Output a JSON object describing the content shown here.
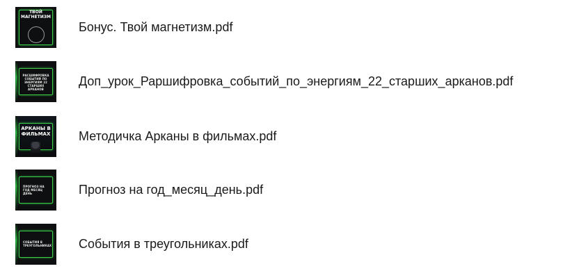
{
  "files": [
    {
      "name": "Бонус. Твой магнетизм.pdf",
      "thumbnail_icon": "pdf-cover-thumbnail",
      "thumbnail_text": "ТВОЙ МАГНЕТИЗМ"
    },
    {
      "name": "Доп_урок_Раршифровка_событий_по_энергиям_22_старших_арканов.pdf",
      "thumbnail_icon": "pdf-cover-thumbnail",
      "thumbnail_text": "РАСШИФРОВКА СОБЫТИЙ ПО ЭНЕРГИЯМ 22 СТАРШИХ АРКАНОВ"
    },
    {
      "name": "Методичка Арканы в фильмах.pdf",
      "thumbnail_icon": "pdf-cover-thumbnail",
      "thumbnail_text": "АРКАНЫ В ФИЛЬМАХ"
    },
    {
      "name": "Прогноз на год_месяц_день.pdf",
      "thumbnail_icon": "pdf-cover-thumbnail",
      "thumbnail_text": "ПРОГНОЗ НА ГОД МЕСЯЦ ДЕНЬ"
    },
    {
      "name": "События в треугольниках.pdf",
      "thumbnail_icon": "pdf-cover-thumbnail",
      "thumbnail_text": "СОБЫТИЯ В ТРЕУГОЛЬНИКАХ"
    }
  ],
  "colors": {
    "thumbnail_bg": "#0e0f10",
    "neon_accent": "#3ad04a",
    "text": "#1a1a1a",
    "background": "#ffffff"
  }
}
